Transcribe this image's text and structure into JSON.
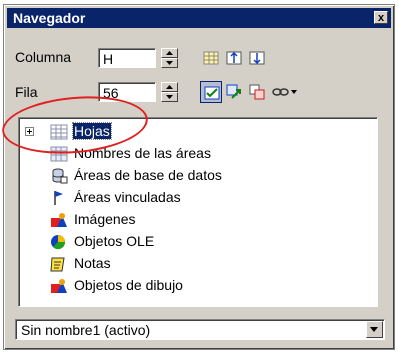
{
  "window": {
    "title": "Navegador",
    "close_label": "x"
  },
  "column": {
    "label": "Columna",
    "value": "H"
  },
  "row": {
    "label": "Fila",
    "value": "56"
  },
  "toolbar": {
    "icons": [
      "data-range-icon",
      "start-icon",
      "end-icon",
      "contents-toggle-icon",
      "scenarios-icon",
      "drag-mode-icon",
      "link-icon"
    ],
    "dropdown_arrow": "▾"
  },
  "tree": {
    "items": [
      {
        "label": "Hojas",
        "icon": "sheet-icon",
        "selected": true,
        "expandable": true
      },
      {
        "label": "Nombres de las áreas",
        "icon": "named-range-icon"
      },
      {
        "label": "Áreas de base de datos",
        "icon": "database-icon"
      },
      {
        "label": "Áreas vinculadas",
        "icon": "linked-area-icon"
      },
      {
        "label": "Imágenes",
        "icon": "image-icon"
      },
      {
        "label": "Objetos OLE",
        "icon": "ole-object-icon"
      },
      {
        "label": "Notas",
        "icon": "note-icon"
      },
      {
        "label": "Objetos de dibujo",
        "icon": "drawing-object-icon"
      }
    ]
  },
  "document_select": {
    "value": "Sin nombre1 (activo)"
  },
  "colors": {
    "titlebar": "#0a246a",
    "selection": "#0a246a",
    "annotation": "#e02020"
  }
}
